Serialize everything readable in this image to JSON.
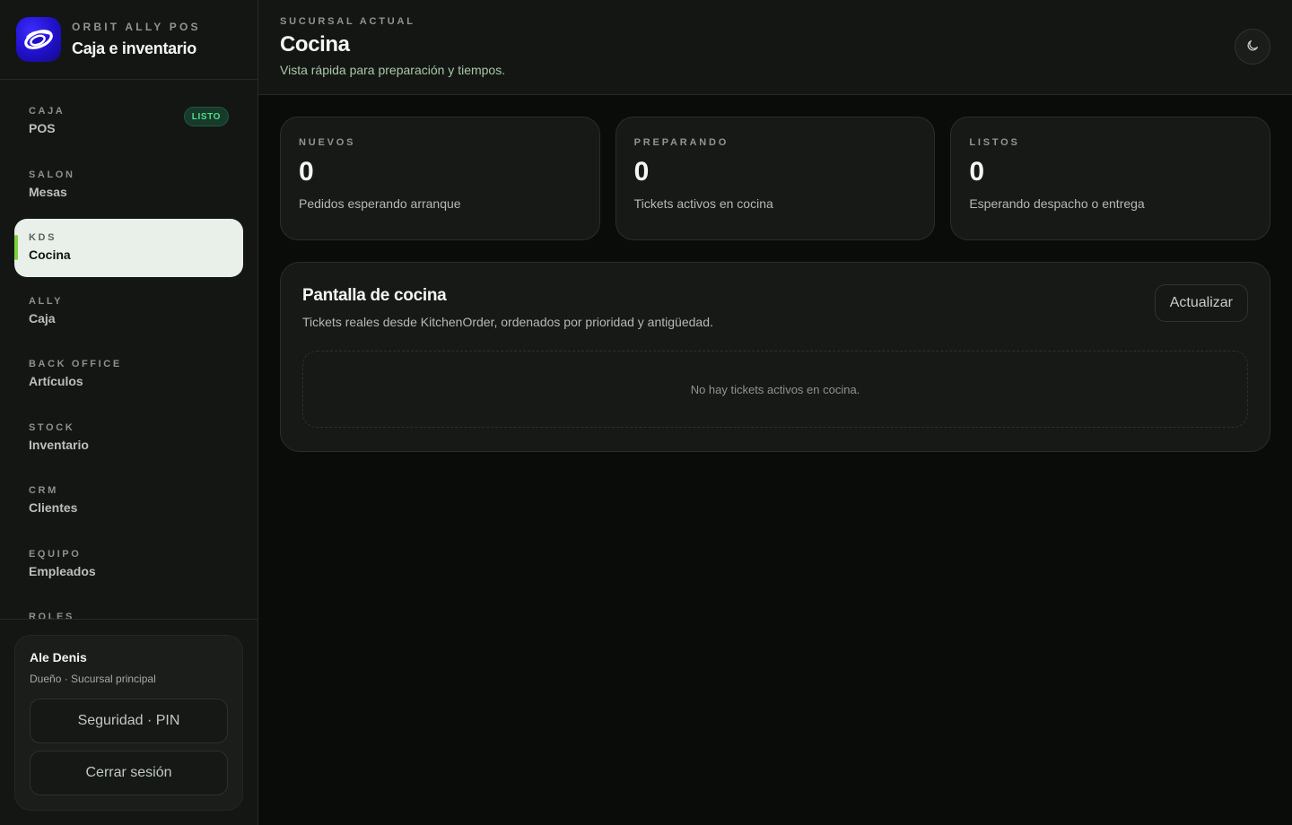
{
  "brand": {
    "kicker": "ORBIT ALLY POS",
    "title": "Caja e inventario",
    "logo_icon": "orbit-logo-icon",
    "logo_color": "#2010c8"
  },
  "nav": {
    "items": [
      {
        "kicker": "CAJA",
        "label": "POS",
        "badge": "LISTO",
        "active": false
      },
      {
        "kicker": "SALON",
        "label": "Mesas",
        "active": false
      },
      {
        "kicker": "KDS",
        "label": "Cocina",
        "active": true
      },
      {
        "kicker": "ALLY",
        "label": "Caja",
        "active": false
      },
      {
        "kicker": "BACK OFFICE",
        "label": "Artículos",
        "active": false
      },
      {
        "kicker": "STOCK",
        "label": "Inventario",
        "active": false
      },
      {
        "kicker": "CRM",
        "label": "Clientes",
        "active": false
      },
      {
        "kicker": "EQUIPO",
        "label": "Empleados",
        "active": false
      },
      {
        "kicker": "ROLES",
        "label": "",
        "active": false
      }
    ],
    "active_accent": "#7ad33a"
  },
  "user": {
    "name": "Ale Denis",
    "role": "Dueño · Sucursal principal",
    "security_label": "Seguridad · PIN",
    "logout_label": "Cerrar sesión"
  },
  "header": {
    "kicker": "SUCURSAL ACTUAL",
    "title": "Cocina",
    "subtitle": "Vista rápida para preparación y tiempos.",
    "theme_icon": "moon-icon"
  },
  "stats": [
    {
      "kicker": "NUEVOS",
      "value": "0",
      "desc": "Pedidos esperando arranque"
    },
    {
      "kicker": "PREPARANDO",
      "value": "0",
      "desc": "Tickets activos en cocina"
    },
    {
      "kicker": "LISTOS",
      "value": "0",
      "desc": "Esperando despacho o entrega"
    }
  ],
  "panel": {
    "title": "Pantalla de cocina",
    "subtitle": "Tickets reales desde KitchenOrder, ordenados por prioridad y antigüedad.",
    "refresh_label": "Actualizar",
    "empty_text": "No hay tickets activos en cocina."
  }
}
